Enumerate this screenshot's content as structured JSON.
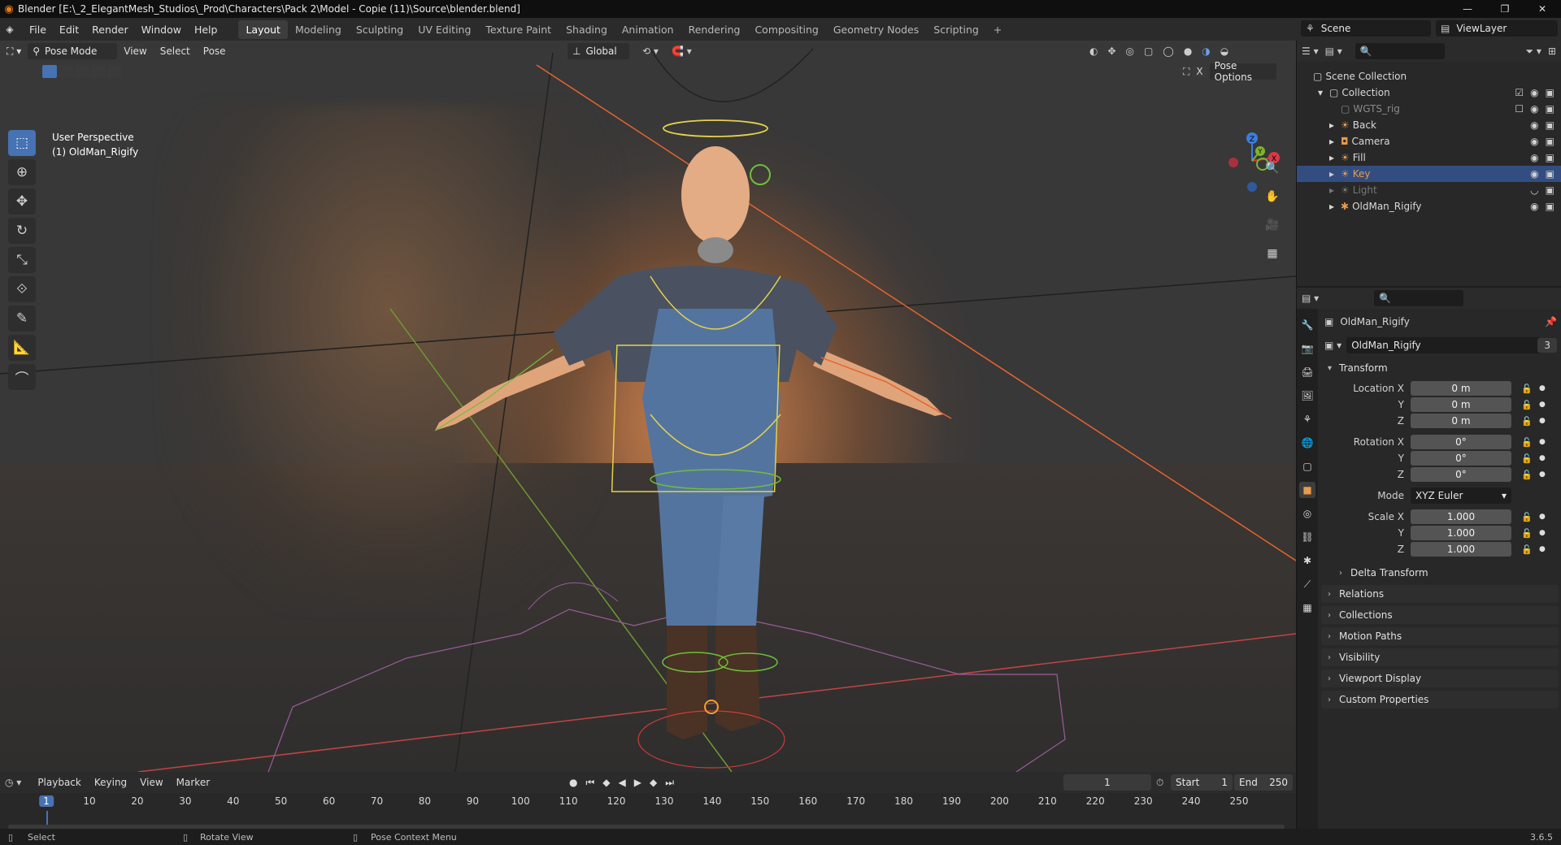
{
  "window": {
    "title": "Blender [E:\\_2_ElegantMesh_Studios\\_Prod\\Characters\\Pack 2\\Model - Copie (11)\\Source\\blender.blend]"
  },
  "menu": [
    "File",
    "Edit",
    "Render",
    "Window",
    "Help"
  ],
  "workspaces": [
    "Layout",
    "Modeling",
    "Sculpting",
    "UV Editing",
    "Texture Paint",
    "Shading",
    "Animation",
    "Rendering",
    "Compositing",
    "Geometry Nodes",
    "Scripting",
    "+"
  ],
  "active_workspace": "Layout",
  "scene": {
    "name": "Scene",
    "view_layer": "ViewLayer"
  },
  "viewport": {
    "mode": "Pose Mode",
    "menus": [
      "View",
      "Select",
      "Pose"
    ],
    "orientation": "Global",
    "pose_options": "Pose Options",
    "info_line1": "User Perspective",
    "info_line2": "(1) OldMan_Rigify",
    "gizmo": {
      "x": "X",
      "y": "Y",
      "z": "Z"
    }
  },
  "outliner": {
    "root": "Scene Collection",
    "collection": "Collection",
    "items": [
      {
        "name": "WGTS_rig",
        "dim": true
      },
      {
        "name": "Back",
        "dim": false
      },
      {
        "name": "Camera",
        "dim": false
      },
      {
        "name": "Fill",
        "dim": false
      },
      {
        "name": "Key",
        "dim": false,
        "selected": true
      },
      {
        "name": "Light",
        "dim": true
      },
      {
        "name": "OldMan_Rigify",
        "dim": false
      }
    ]
  },
  "properties": {
    "object_name": "OldMan_Rigify",
    "data_name": "OldMan_Rigify",
    "data_users": "3",
    "transform_label": "Transform",
    "location": {
      "label": "Location X",
      "x": "0 m",
      "y": "0 m",
      "z": "0 m"
    },
    "rotation": {
      "label": "Rotation X",
      "x": "0°",
      "y": "0°",
      "z": "0°"
    },
    "mode_label": "Mode",
    "mode_value": "XYZ Euler",
    "scale": {
      "label": "Scale X",
      "x": "1.000",
      "y": "1.000",
      "z": "1.000"
    },
    "axis_y": "Y",
    "axis_z": "Z",
    "delta": "Delta Transform",
    "panels": [
      "Relations",
      "Collections",
      "Motion Paths",
      "Visibility",
      "Viewport Display",
      "Custom Properties"
    ]
  },
  "timeline": {
    "menus": [
      "Playback",
      "Keying",
      "View",
      "Marker"
    ],
    "current_frame": "1",
    "start_label": "Start",
    "start": "1",
    "end_label": "End",
    "end": "250",
    "ruler": [
      "1",
      "10",
      "20",
      "30",
      "40",
      "50",
      "60",
      "70",
      "80",
      "90",
      "100",
      "110",
      "120",
      "130",
      "140",
      "150",
      "160",
      "170",
      "180",
      "190",
      "200",
      "210",
      "220",
      "230",
      "240",
      "250"
    ]
  },
  "status": {
    "left": "Select",
    "middle": "Rotate View",
    "right": "Pose Context Menu",
    "version": "3.6.5"
  },
  "colors": {
    "accent": "#4772b3",
    "selected_row": "#334d80",
    "orange": "#e87d0d"
  }
}
